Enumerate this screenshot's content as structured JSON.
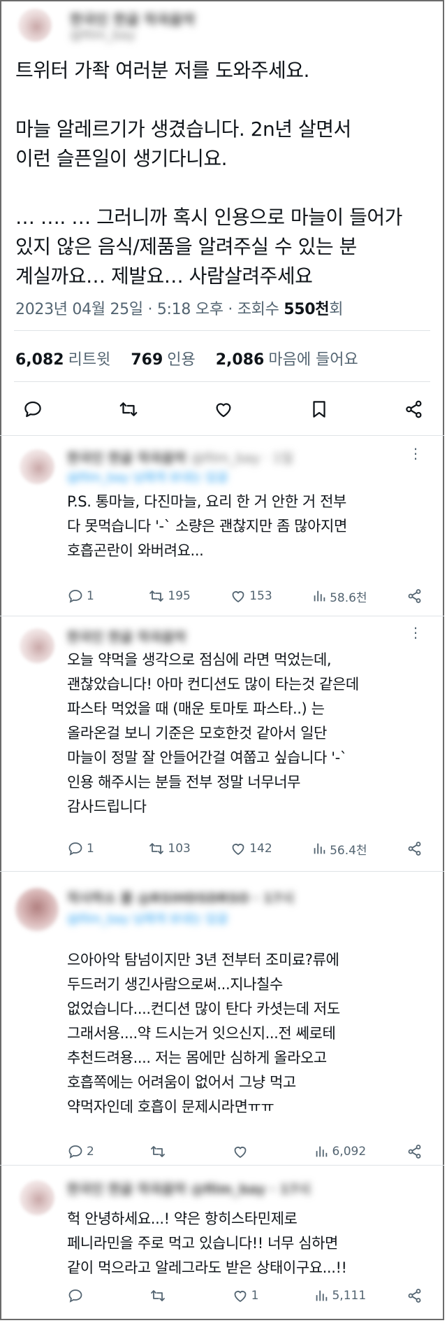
{
  "tweet": {
    "author_blurred": "한국인 한글 작곡음악",
    "handle_blurred": "@film_bay",
    "text": "트위터 가좍 여러분 저를 도와주세요.\n\n마늘 알레르기가 생겼습니다. 2n년 살면서\n이런 슬픈일이 생기다니요.\n\n… …. … 그러니까 혹시 인용으로 마늘이 들어가\n있지 않은 음식/제품을 알려주실 수 있는 분\n계실까요… 제발요… 사람살려주세요",
    "date": "2023년 04월 25일 · 5:18 오후 · 조회수 ",
    "views": "550천",
    "views_suffix": "회",
    "retweets_count": "6,082",
    "retweets_label": "리트윗",
    "quotes_count": "769",
    "quotes_label": "인용",
    "likes_count": "2,086",
    "likes_label": "마음에 들어요"
  },
  "replies": [
    {
      "author_blurred": "한국인 한글 작곡음악",
      "handle_blurred": "@film_bay · 1일",
      "to_blurred": "@film_bay 님에게 보내는 답글",
      "text": "P.S. 통마늘, 다진마늘, 요리 한 거 안한 거 전부\n다 못먹습니다 '-` 소량은 괜찮지만 좀 많아지면\n호흡곤란이 와버려요...",
      "replies": "1",
      "retweets": "195",
      "likes": "153",
      "views": "58.6천"
    },
    {
      "author_blurred": "한국인 한글 작곡음악",
      "handle_blurred": "",
      "to_blurred": "",
      "text": "오늘 약먹을 생각으로 점심에 라면 먹었는데,\n괜찮았습니다! 아마 컨디션도 많이 타는것 같은데\n파스타 먹었을 때 (매운 토마토 파스타..) 는\n올라온걸 보니 기준은 모호한것 같아서 일단\n마늘이 정말 잘 안들어간걸 여쭙고 싶습니다 '-`\n인용 해주시는 분들 전부 정말 너무너무\n감사드립니다",
      "replies": "1",
      "retweets": "103",
      "likes": "142",
      "views": "56.4천"
    },
    {
      "author_blurred": "작사하소 쿨 @RSIHDSDRSO · 17시",
      "handle_blurred": "",
      "to_blurred": "@film_bay 님에게 보내는 답글",
      "text": "으아아악 탐넘이지만 3년 전부터 조미료?류에\n두드러기 생긴사람으로써...지나칠수\n없었습니다....컨디션 많이 탄다 카셧는데 저도\n그래서용....약 드시는거 잇으신지...전 쎄로테\n추천드려용.... 저는 몸에만 심하게 올라오고\n호흡쪽에는 어려움이 없어서 그냥 먹고\n약먹자인데 호흡이 문제시라면ㅠㅠ",
      "replies": "2",
      "retweets": "",
      "likes": "",
      "views": "6,092"
    },
    {
      "author_blurred": "한국인 한글 작곡음악 @film_bay · 17시",
      "handle_blurred": "",
      "to_blurred": "",
      "text": "헉 안녕하세요...! 약은 항히스타민제로\n페니라민을 주로 먹고 있습니다!! 너무 심하면\n같이 먹으라고 알레그라도 받은 상태이구요...!!",
      "replies": "",
      "retweets": "",
      "likes": "1",
      "views": "5,111"
    }
  ],
  "icons": {
    "reply": "reply-icon",
    "retweet": "retweet-icon",
    "like": "heart-icon",
    "bookmark": "bookmark-icon",
    "share": "share-icon",
    "views": "views-icon",
    "more": "more-icon"
  },
  "colors": {
    "text": "#0f1419",
    "secondary": "#536471",
    "link": "#1d9bf0",
    "divider": "#dfe3e6"
  }
}
